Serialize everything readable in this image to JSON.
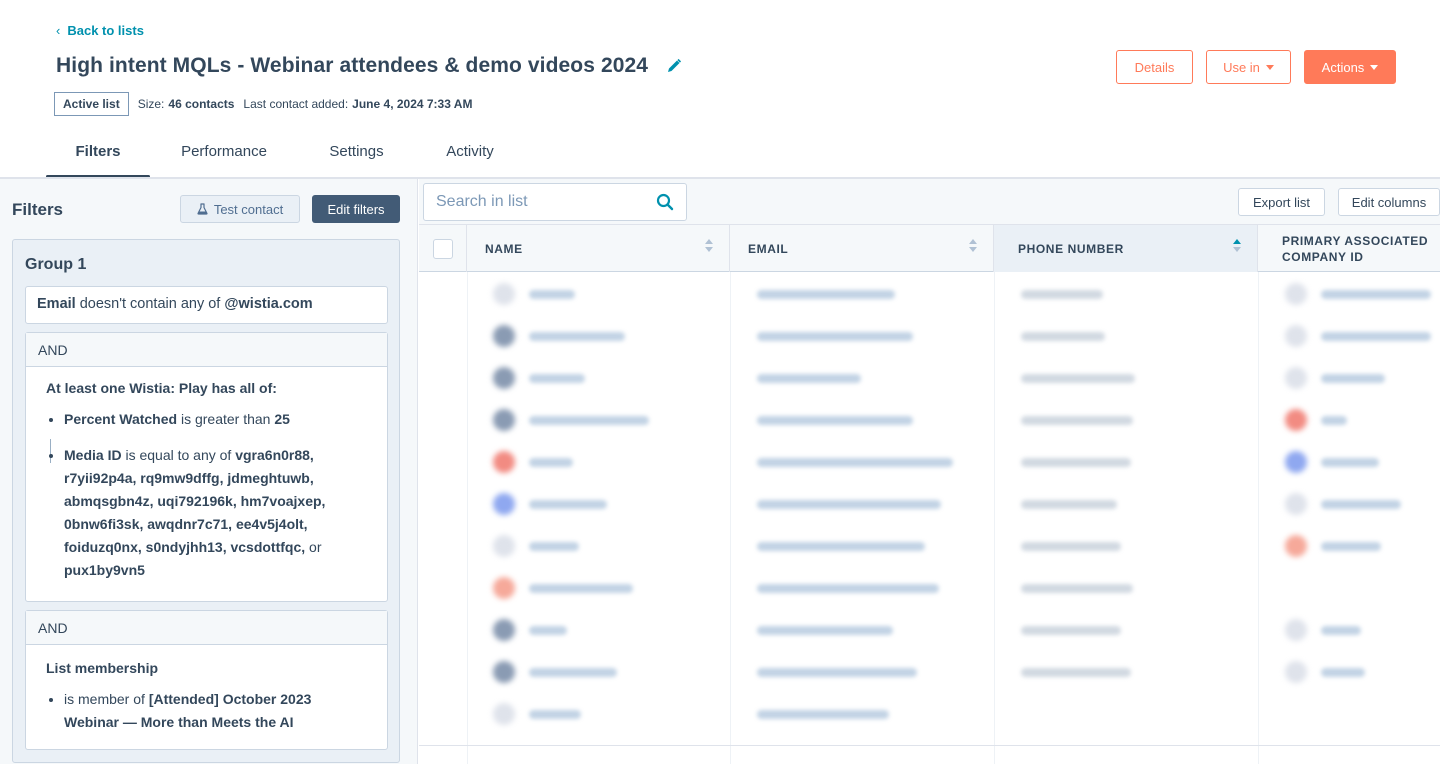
{
  "header": {
    "back_label": "Back to lists",
    "title": "High intent MQLs - Webinar attendees & demo videos 2024",
    "status_badge": "Active list",
    "size_label": "Size:",
    "size_value": "46 contacts",
    "last_added_label": "Last contact added:",
    "last_added_value": "June 4, 2024 7:33 AM",
    "buttons": {
      "details": "Details",
      "use_in": "Use in",
      "actions": "Actions"
    }
  },
  "tabs": [
    "Filters",
    "Performance",
    "Settings",
    "Activity"
  ],
  "active_tab": "Filters",
  "filters": {
    "heading": "Filters",
    "test_contact": "Test contact",
    "edit_filters": "Edit filters",
    "group_title": "Group 1",
    "condition1": {
      "field": "Email",
      "op": "doesn't contain any of",
      "value": "@wistia.com"
    },
    "and_label": "AND",
    "condition2": {
      "title": "At least one Wistia: Play has all of:",
      "rule1_field": "Percent Watched",
      "rule1_op": "is greater than",
      "rule1_value": "25",
      "rule2_field": "Media ID",
      "rule2_op": "is equal to any of",
      "media_ids_line1": "vgra6n0r88,",
      "media_ids_line2": "r7yii92p4a, rq9mw9dffg, jdmeghtuwb,",
      "media_ids_line3": "abmqsgbn4z, uqi792196k, hm7voajxep,",
      "media_ids_line4": "0bnw6fi3sk, awqdnr7c71, ee4v5j4olt,",
      "media_ids_line5a": "foiduzq0nx, s0ndyjhh13, vcsdottfqc,",
      "media_ids_line5b": "or",
      "media_ids_line6": "pux1by9vn5"
    },
    "condition3": {
      "title": "List membership",
      "op": "is member of",
      "value_line1": "[Attended] October 2023",
      "value_line2": "Webinar — More than Meets the AI"
    }
  },
  "table": {
    "search_placeholder": "Search in list",
    "export": "Export list",
    "edit_columns": "Edit columns",
    "columns": {
      "name": "NAME",
      "email": "EMAIL",
      "phone": "PHONE NUMBER",
      "company_line1": "PRIMARY ASSOCIATED",
      "company_line2": "COMPANY ID"
    },
    "rows_note": "rows blurred"
  },
  "colors": {
    "accent": "#ff7a59",
    "link": "#0091ae",
    "text": "#33475b",
    "panel_bg": "#f5f8fa"
  }
}
